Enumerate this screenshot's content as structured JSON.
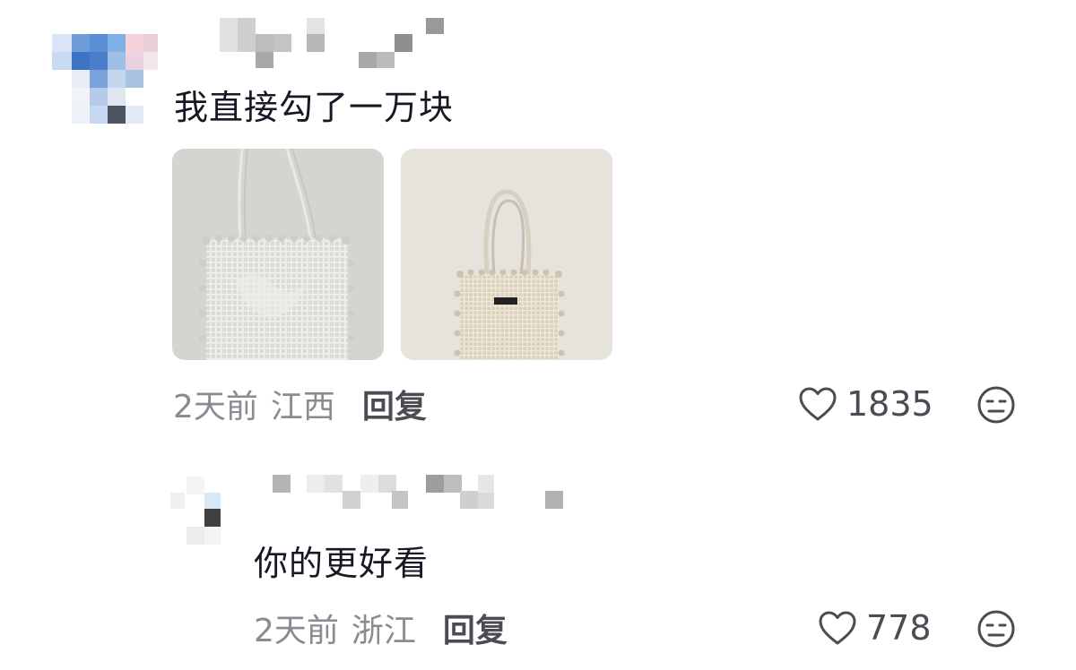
{
  "comments": [
    {
      "text": "我直接勾了一万块",
      "time": "2天前",
      "location": "江西",
      "reply_label": "回复",
      "like_count": "1835",
      "images": [
        {
          "alt": "crochet-tote-bag-closeup"
        },
        {
          "alt": "crochet-tote-bag-full"
        }
      ]
    },
    {
      "text": "你的更好看",
      "time": "2天前",
      "location": "浙江",
      "reply_label": "回复",
      "like_count": "778"
    }
  ],
  "icons": {
    "like": "heart-outline-icon",
    "dislike": "neutral-face-icon"
  },
  "colors": {
    "primary_text": "#161823",
    "secondary_text": "#8a8b91",
    "reply_text": "#4b4c53",
    "icon_stroke": "#4b4c53"
  }
}
